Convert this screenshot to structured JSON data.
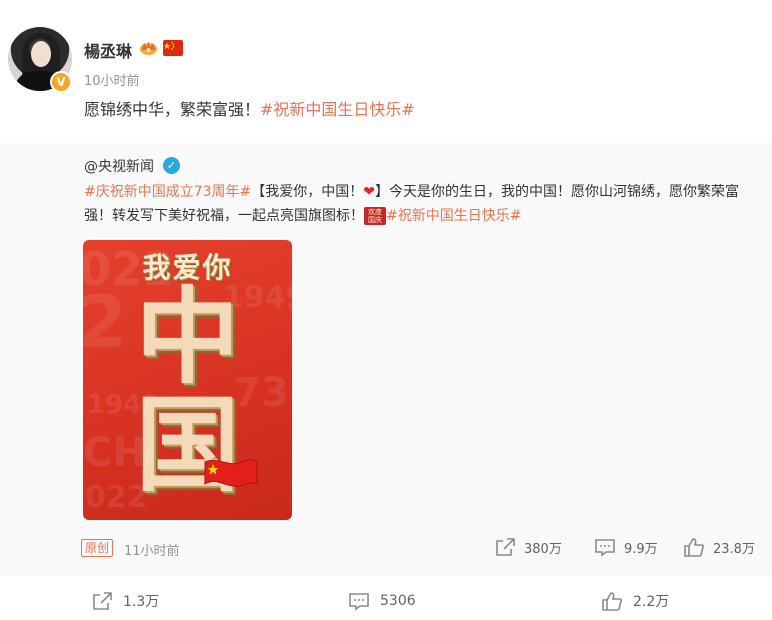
{
  "post": {
    "username": "楊丞琳",
    "time": "10小时前",
    "text_main": "愿锦绣中华，繁荣富强！",
    "text_hashtag": "#祝新中国生日快乐#"
  },
  "repost": {
    "author": "@央视新闻",
    "hashtag1": "#庆祝新中国成立73周年#",
    "text_part1": "【我爱你，中国！",
    "text_part2": "】今天是你的生日，我的中国！愿你山河锦绣，愿你繁荣富强！转发写下美好祝福，一起点亮国旗图标！",
    "badge_text_line1": "欢度",
    "badge_text_line2": "国庆",
    "hashtag2": "#祝新中国生日快乐#",
    "poster": {
      "title": "我爱你",
      "char1": "中",
      "char2": "国"
    },
    "source_badge": "原创",
    "time": "11小时前",
    "stats": {
      "reposts": "380万",
      "comments": "9.9万",
      "likes": "23.8万"
    }
  },
  "footer": {
    "reposts": "1.3万",
    "comments": "5306",
    "likes": "2.2万"
  },
  "icons": [
    "crown-icon",
    "china-flag-icon",
    "verified-icon",
    "repost-icon",
    "comment-icon",
    "like-icon"
  ],
  "colors": {
    "hashtag": "#eb7350",
    "verified_blue": "#2ca8e0",
    "verified_gold": "#f5a623",
    "poster_red": "#d83222"
  }
}
